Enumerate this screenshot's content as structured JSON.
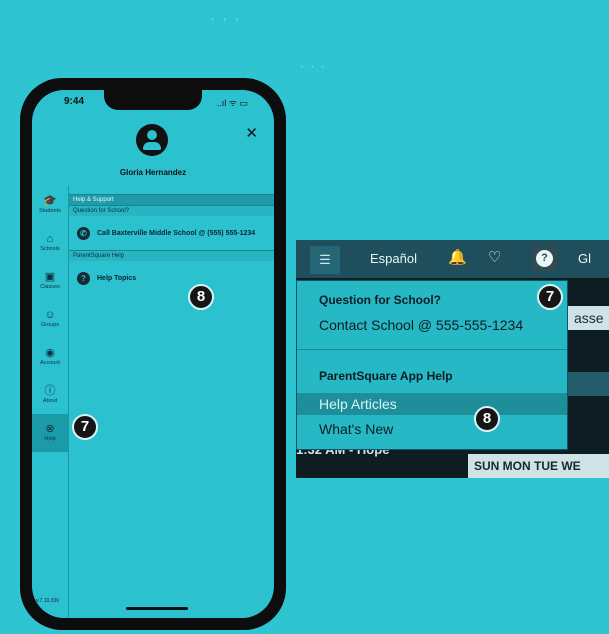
{
  "mobile": {
    "status": {
      "time": "9:44",
      "icons": "..ıl ᯤ ▭"
    },
    "user_name": "Gloria Hernandez",
    "sidebar": [
      {
        "label": "Students",
        "icon": "graduation-cap"
      },
      {
        "label": "Schools",
        "icon": "school"
      },
      {
        "label": "Classes",
        "icon": "classroom"
      },
      {
        "label": "Groups",
        "icon": "people"
      },
      {
        "label": "Account",
        "icon": "account"
      },
      {
        "label": "About",
        "icon": "info"
      },
      {
        "label": "Help",
        "icon": "help"
      }
    ],
    "section_title": "Help & Support",
    "question_label": "Question for School?",
    "call_school": "Call Baxterville Middle School @ (555) 555-1234",
    "app_help_label": "ParentSquare Help",
    "help_topics": "Help Topics",
    "version": "v.7.10.336"
  },
  "desktop": {
    "language_link": "Español",
    "cut_text": "Gl",
    "background_fragments": {
      "tab_text": "asse",
      "time_text": "1:32 AM - Hope",
      "days": "SUN MON TUE WE"
    },
    "dropdown": {
      "question_heading": "Question for School?",
      "contact_school": "Contact School @ 555-555-1234",
      "app_help_heading": "ParentSquare App Help",
      "help_articles": "Help Articles",
      "whats_new": "What's New"
    }
  },
  "callouts": {
    "seven": "7",
    "eight": "8"
  },
  "colors": {
    "background": "#2fc4d2",
    "topbar": "#1f4f5c",
    "highlight": "#1e8e9b"
  }
}
